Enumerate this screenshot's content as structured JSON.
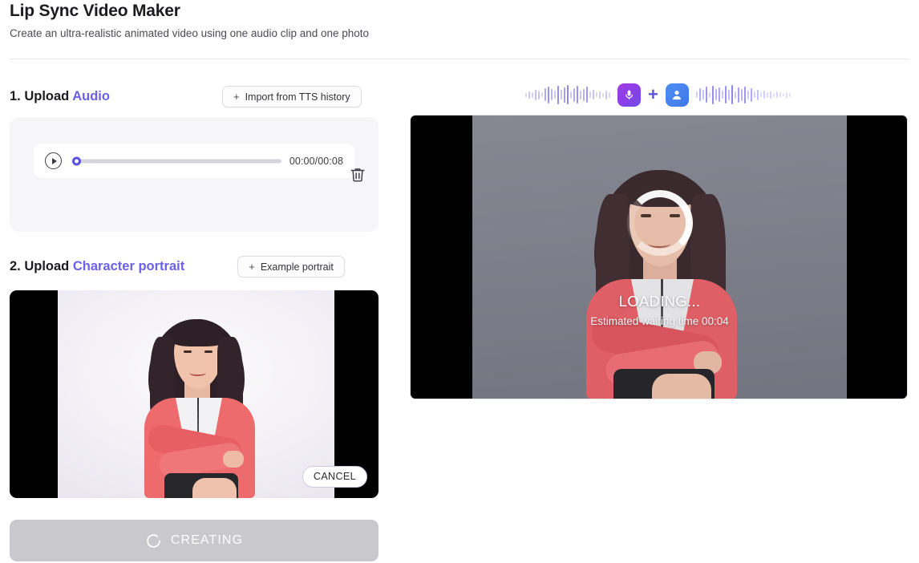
{
  "header": {
    "title": "Lip Sync Video Maker",
    "subtitle": "Create an ultra-realistic animated video using one audio clip and one photo"
  },
  "accent_color": "#6b61e8",
  "section_audio": {
    "number_label": "1. Upload ",
    "accent_label": "Audio",
    "import_button": {
      "plus": "+",
      "label": "Import from TTS history"
    },
    "player": {
      "play_icon": "play-icon",
      "current_time": "00:00",
      "separator": "/",
      "total_time": "00:08",
      "time_display": "00:00/00:08",
      "progress_percent": 0,
      "delete_icon": "trash-icon"
    }
  },
  "section_portrait": {
    "number_label": "2. Upload ",
    "accent_label": "Character portrait",
    "example_button": {
      "plus": "+",
      "label": "Example portrait"
    },
    "cancel_button_label": "CANCEL"
  },
  "create_button": {
    "label": "CREATING",
    "spinner_icon": "spinner-icon",
    "disabled": true
  },
  "preview": {
    "icon_strip": {
      "left_waveform": "waveform-icon",
      "mic_icon": "microphone-icon",
      "plus_icon": "+",
      "person_icon": "person-icon",
      "right_waveform": "waveform-icon"
    },
    "loading_title": "LOADING...",
    "loading_subtitle": "Estimated waiting time 00:04"
  }
}
